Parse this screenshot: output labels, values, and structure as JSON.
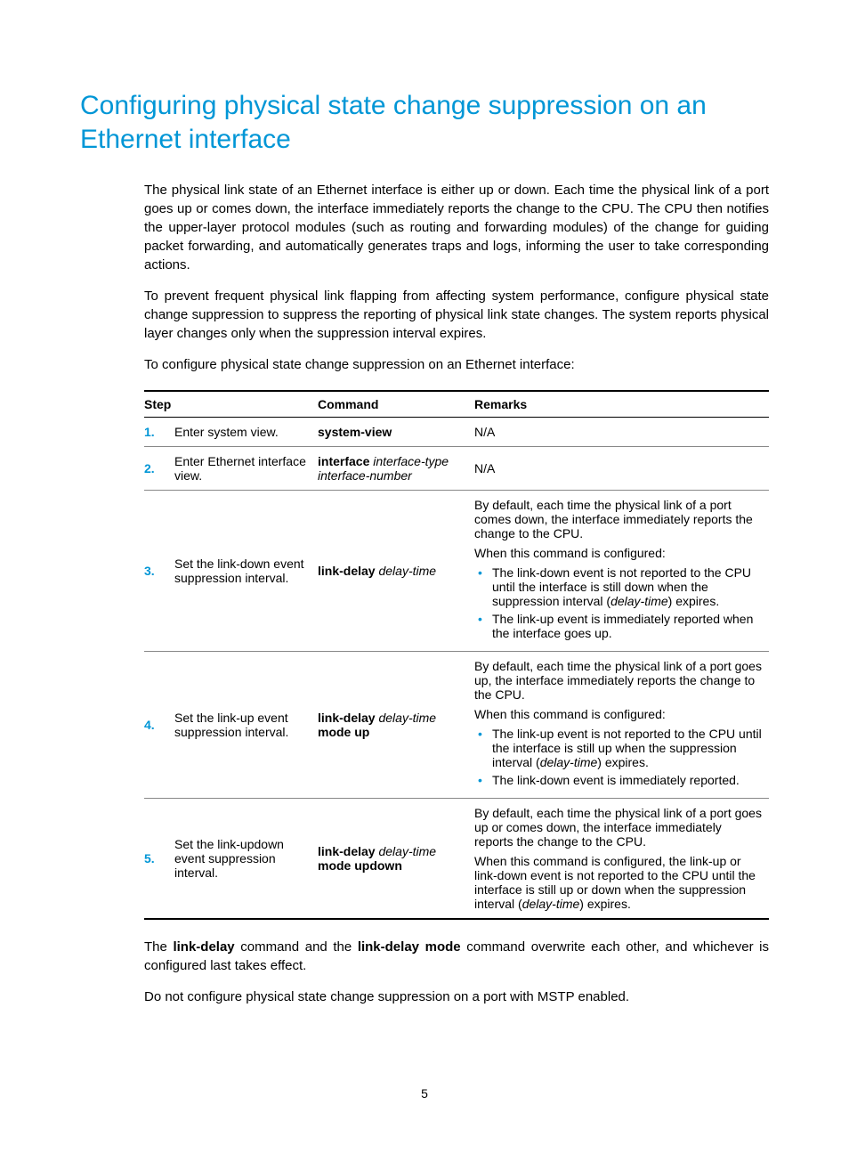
{
  "title": "Configuring physical state change suppression on an Ethernet interface",
  "intro": {
    "p1": "The physical link state of an Ethernet interface is either up or down. Each time the physical link of a port goes up or comes down, the interface immediately reports the change to the CPU. The CPU then notifies the upper-layer protocol modules (such as routing and forwarding modules) of the change for guiding packet forwarding, and automatically generates traps and logs, informing the user to take corresponding actions.",
    "p2": "To prevent frequent physical link flapping from affecting system performance, configure physical state change suppression to suppress the reporting of physical link state changes. The system reports physical layer changes only when the suppression interval expires.",
    "p3": "To configure physical state change suppression on an Ethernet interface:"
  },
  "table": {
    "headers": {
      "step": "Step",
      "command": "Command",
      "remarks": "Remarks"
    },
    "rows": [
      {
        "num": "1.",
        "step": "Enter system view.",
        "cmd_bold1": "system-view",
        "rem_plain": "N/A"
      },
      {
        "num": "2.",
        "step": "Enter Ethernet interface view.",
        "cmd_bold1": "interface",
        "cmd_ital1": "interface-type interface-number",
        "rem_plain": "N/A"
      },
      {
        "num": "3.",
        "step": "Set the link-down event suppression interval.",
        "cmd_bold1": "link-delay",
        "cmd_ital1": "delay-time",
        "rem": {
          "p1": "By default, each time the physical link of a port comes down, the interface immediately reports the change to the CPU.",
          "p2": "When this command is configured:",
          "b1a": "The link-down event is not reported to the CPU until the interface is still down when the suppression interval (",
          "b1i": "delay-time",
          "b1b": ") expires.",
          "b2": "The link-up event is immediately reported when the interface goes up."
        }
      },
      {
        "num": "4.",
        "step": "Set the link-up event suppression interval.",
        "cmd_bold1": "link-delay",
        "cmd_ital1": "delay-time",
        "cmd_bold2": "mode up",
        "rem": {
          "p1": "By default, each time the physical link of a port goes up, the interface immediately reports the change to the CPU.",
          "p2": "When this command is configured:",
          "b1a": "The link-up event is not reported to the CPU until the interface is still up when the suppression interval (",
          "b1i": "delay-time",
          "b1b": ") expires.",
          "b2": "The link-down event is immediately reported."
        }
      },
      {
        "num": "5.",
        "step": "Set the link-updown event suppression interval.",
        "cmd_bold1": "link-delay",
        "cmd_ital1": "delay-time",
        "cmd_bold2": "mode updown",
        "rem": {
          "p1": "By default, each time the physical link of a port goes up or comes down, the interface immediately reports the change to the CPU.",
          "p2a": "When this command is configured, the link-up or link-down event is not reported to the CPU until the interface is still up or down when the suppression interval (",
          "p2i": "delay-time",
          "p2b": ") expires."
        }
      }
    ]
  },
  "outro": {
    "p1a": "The ",
    "p1b": "link-delay",
    "p1c": " command and the ",
    "p1d": "link-delay mode",
    "p1e": " command overwrite each other, and whichever is configured last takes effect.",
    "p2": "Do not configure physical state change suppression on a port with MSTP enabled."
  },
  "page_number": "5"
}
